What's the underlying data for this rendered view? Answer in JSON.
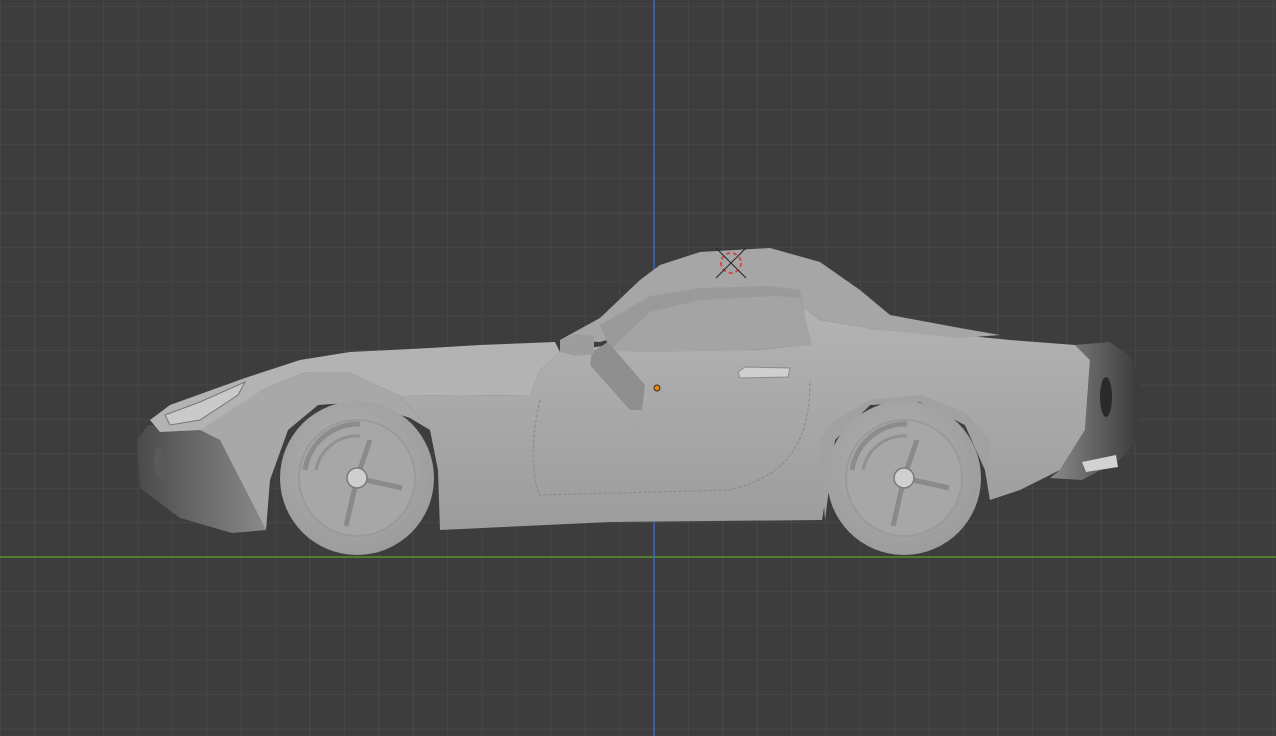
{
  "viewport": {
    "view": "side-orthographic",
    "background_color": "#3d3d3d",
    "grid_minor_color": "#474747",
    "grid_major_color": "#4c4c4c",
    "axis_x_color": "#5f8d2f",
    "axis_z_color": "#3a66c4"
  },
  "scene": {
    "object": "car-model",
    "shading": "solid-gray",
    "body_color": "#a9a9a9",
    "dark_part_color": "#3b3b3b",
    "origin_color": "#e08a1a",
    "cursor_colors": [
      "#d24a4a",
      "#ffffff"
    ]
  }
}
